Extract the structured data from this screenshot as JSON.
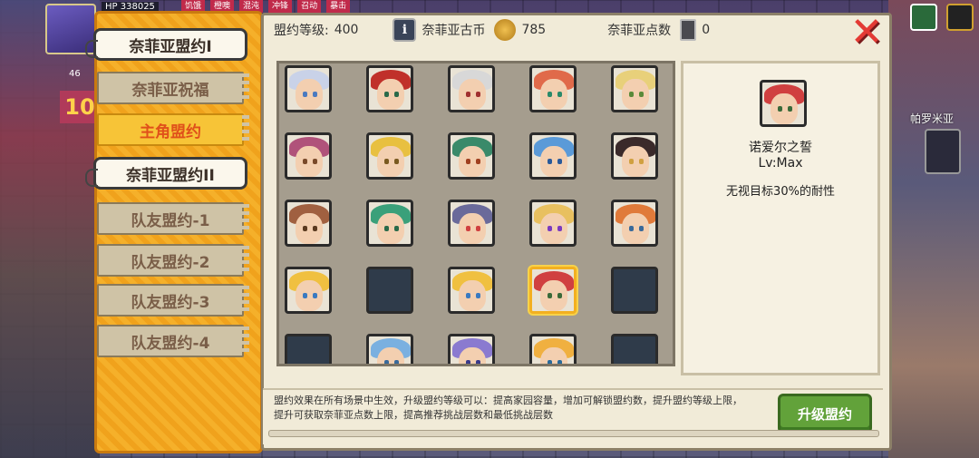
{
  "hud": {
    "hp_label": "HP",
    "hp_value": "338025",
    "top_tags": [
      "饥饿",
      "橙噢",
      "混沌",
      "冲锋",
      "召动",
      "暴击"
    ],
    "level": "46",
    "big_number": "10"
  },
  "menu": {
    "items": [
      {
        "label": "奈菲亚盟约I",
        "state": "active"
      },
      {
        "label": "奈菲亚祝福",
        "state": "normal"
      },
      {
        "label": "主角盟约",
        "state": "orange"
      },
      {
        "label": "奈菲亚盟约II",
        "state": "active"
      },
      {
        "label": "队友盟约-1",
        "state": "normal"
      },
      {
        "label": "队友盟约-2",
        "state": "normal"
      },
      {
        "label": "队友盟约-3",
        "state": "normal"
      },
      {
        "label": "队友盟约-4",
        "state": "normal"
      }
    ]
  },
  "stats": {
    "level_label": "盟约等级:",
    "level_value": "400",
    "coin_label": "奈菲亚古币",
    "coin_value": "785",
    "points_label": "奈菲亚点数",
    "points_value": "0"
  },
  "portraits": [
    {
      "hair": "#c9d2e8",
      "eye": "#4a7ac0"
    },
    {
      "hair": "#c0302a",
      "eye": "#2a6a4a"
    },
    {
      "hair": "#d8d8d8",
      "eye": "#a03030"
    },
    {
      "hair": "#e06a4a",
      "eye": "#2a8a6a"
    },
    {
      "hair": "#e8d07a",
      "eye": "#5a8a3a"
    },
    {
      "hair": "#b0527a",
      "eye": "#7a4a2a"
    },
    {
      "hair": "#e8c040",
      "eye": "#7a5a20"
    },
    {
      "hair": "#3a8a6a",
      "eye": "#a04020"
    },
    {
      "hair": "#5a9ad8",
      "eye": "#2a5a9a"
    },
    {
      "hair": "#3a2a2a",
      "eye": "#d0a040"
    },
    {
      "hair": "#a06040",
      "eye": "#5a3a20"
    },
    {
      "hair": "#3aa07a",
      "eye": "#2a6a4a"
    },
    {
      "hair": "#6a6a9a",
      "eye": "#d04040"
    },
    {
      "hair": "#e8c060",
      "eye": "#7a3ac0"
    },
    {
      "hair": "#e07a3a",
      "eye": "#3a6a9a"
    },
    {
      "hair": "#f0c040",
      "eye": "#3a7ac0"
    },
    {
      "hair": "",
      "eye": ""
    },
    {
      "hair": "#f0c040",
      "eye": "#3a7ac0"
    },
    {
      "hair": "#d04040",
      "eye": "#3a6a3a"
    },
    {
      "hair": "",
      "eye": ""
    },
    {
      "hair": "",
      "eye": ""
    },
    {
      "hair": "#7ab0e0",
      "eye": "#3a6a9a"
    },
    {
      "hair": "#8a7ad0",
      "eye": "#3a3a8a"
    },
    {
      "hair": "#f0b040",
      "eye": "#2a6a9a"
    },
    {
      "hair": "",
      "eye": ""
    }
  ],
  "selected_index": 18,
  "detail": {
    "name": "诺爱尔之誓",
    "level": "Lv:Max",
    "description": "无视目标30%的耐性",
    "hair": "#d04040",
    "eye": "#3a6a3a"
  },
  "footer": {
    "line1": "盟约效果在所有场景中生效，升级盟约等级可以：提高家园容量，增加可解锁盟约数，提升盟约等级上限，",
    "line2": "提升可获取奈菲亚点数上限，提高推荐挑战层数和最低挑战层数",
    "upgrade_label": "升级盟约"
  },
  "city_label": "帕罗米亚",
  "colors": {
    "accent": "#f3b020",
    "close": "#e43a34",
    "upgrade": "#62a23a"
  }
}
